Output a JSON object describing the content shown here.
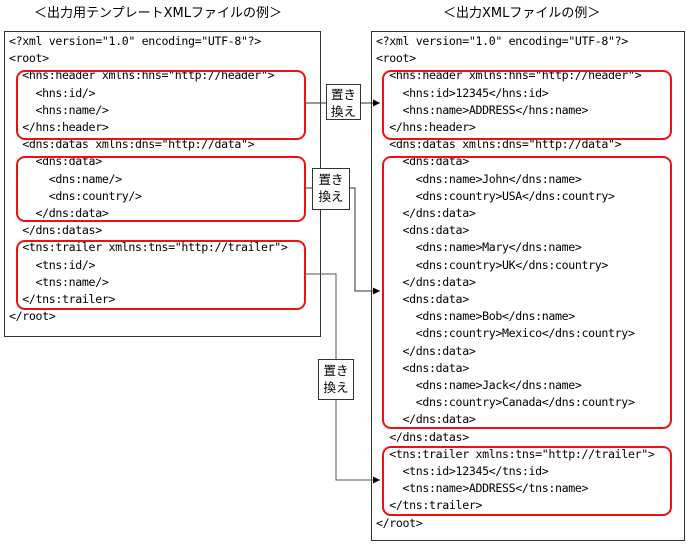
{
  "titles": {
    "template": "＜出力用テンプレートXMLファイルの例＞",
    "output": "＜出力XMLファイルの例＞"
  },
  "template_lines": [
    "<?xml version=\"1.0\" encoding=\"UTF-8\"?>",
    "<root>",
    "  <hns:header xmlns:hns=\"http://header\">",
    "    <hns:id/>",
    "    <hns:name/>",
    "  </hns:header>",
    "  <dns:datas xmlns:dns=\"http://data\">",
    "    <dns:data>",
    "      <dns:name/>",
    "      <dns:country/>",
    "    </dns:data>",
    "  </dns:datas>",
    "  <tns:trailer xmlns:tns=\"http://trailer\">",
    "    <tns:id/>",
    "    <tns:name/>",
    "  </tns:trailer>",
    "</root>"
  ],
  "output_lines": [
    "<?xml version=\"1.0\" encoding=\"UTF-8\"?>",
    "<root>",
    "  <hns:header xmlns:hns=\"http://header\">",
    "    <hns:id>12345</hns:id>",
    "    <hns:name>ADDRESS</hns:name>",
    "  </hns:header>",
    "  <dns:datas xmlns:dns=\"http://data\">",
    "    <dns:data>",
    "      <dns:name>John</dns:name>",
    "      <dns:country>USA</dns:country>",
    "    </dns:data>",
    "    <dns:data>",
    "      <dns:name>Mary</dns:name>",
    "      <dns:country>UK</dns:country>",
    "    </dns:data>",
    "    <dns:data>",
    "      <dns:name>Bob</dns:name>",
    "      <dns:country>Mexico</dns:country>",
    "    </dns:data>",
    "    <dns:data>",
    "      <dns:name>Jack</dns:name>",
    "      <dns:country>Canada</dns:country>",
    "    </dns:data>",
    "  </dns:datas>",
    "  <tns:trailer xmlns:tns=\"http://trailer\">",
    "    <tns:id>12345</tns:id>",
    "    <tns:name>ADDRESS</tns:name>",
    "  </tns:trailer>",
    "</root>"
  ],
  "connector_labels": [
    {
      "line1": "置き",
      "line2": "換え"
    },
    {
      "line1": "置き",
      "line2": "換え"
    },
    {
      "line1": "置き",
      "line2": "換え"
    }
  ],
  "colors": {
    "highlight": "#ee1111",
    "line": "#333333"
  }
}
